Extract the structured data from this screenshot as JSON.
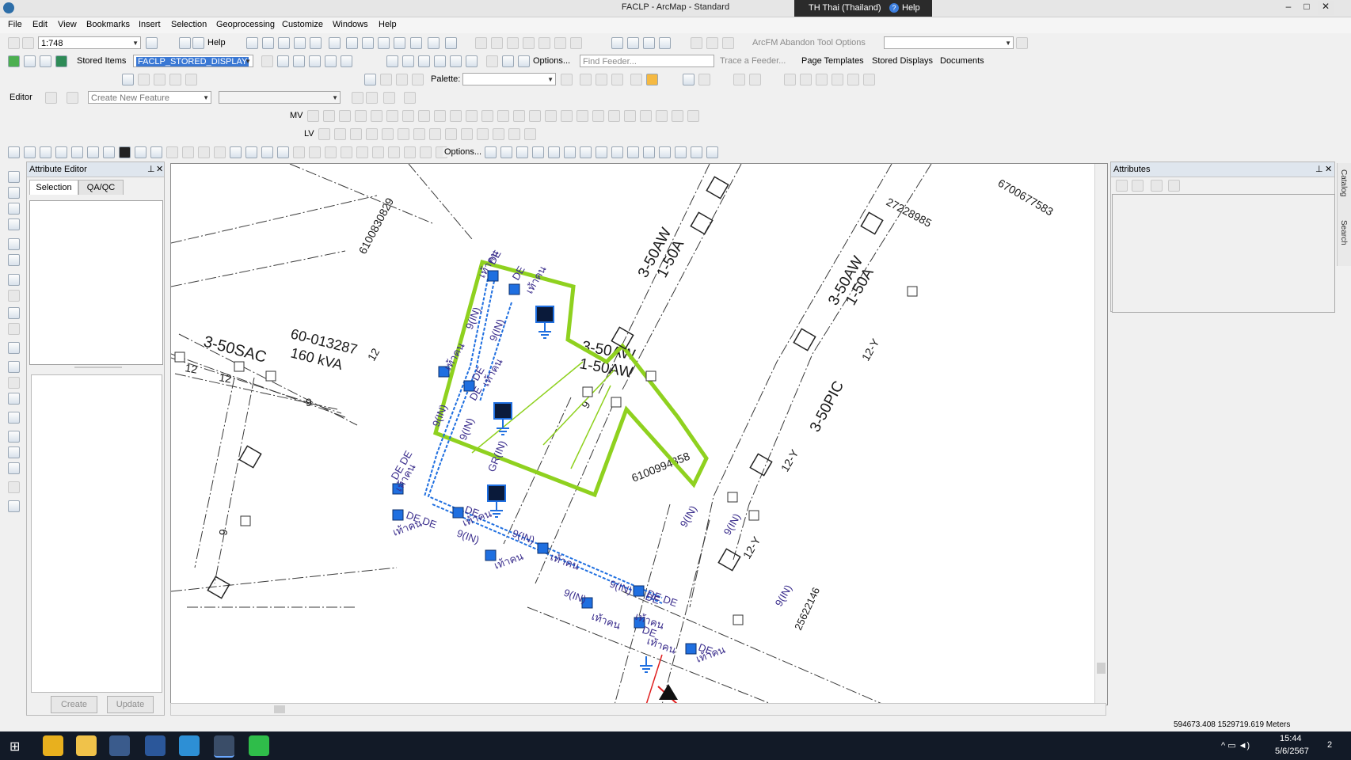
{
  "window": {
    "title": "FACLP - ArcMap - Standard",
    "language": "TH Thai (Thailand)",
    "help": "Help",
    "controls": [
      "–",
      "□",
      "✕"
    ]
  },
  "menu": [
    "File",
    "Edit",
    "View",
    "Bookmarks",
    "Insert",
    "Selection",
    "Geoprocessing",
    "Customize",
    "Windows",
    "Help"
  ],
  "toolbar": {
    "scale": "1:748",
    "help_label": "Help",
    "arcfm_abandon": "ArcFM Abandon Tool Options",
    "stored_items": "Stored Items",
    "stored_display": "FACLP_STORED_DISPLAY",
    "options_label": "Options...",
    "find_feeder_placeholder": "Find Feeder...",
    "trace_feeder": "Trace a Feeder...",
    "page_templates": "Page Templates",
    "stored_displays": "Stored Displays",
    "documents": "Documents",
    "palette_label": "Palette:",
    "editor_label": "Editor",
    "create_new_feature": "Create New Feature",
    "mv_label": "MV",
    "lv_label": "LV",
    "options2_label": "Options..."
  },
  "attribute_editor": {
    "title": "Attribute Editor",
    "tabs": [
      "Selection",
      "QA/QC"
    ],
    "create_button": "Create",
    "update_button": "Update"
  },
  "attributes_panel": {
    "title": "Attributes"
  },
  "right_strip": [
    "Catalog",
    "Search"
  ],
  "status": {
    "coordinates": "594673.408  1529719.619 Meters"
  },
  "clock": {
    "time": "15:44",
    "date": "5/6/2567",
    "notifications": "2"
  },
  "map_labels": {
    "id1": "6100830829",
    "id2": "6700677583",
    "id3": "27228985",
    "id4": "6100994358",
    "id5": "25622146",
    "cable1_a": "3-50SAC",
    "cable2_a": "3-50AW",
    "cable2_b": "1-50A",
    "cable3_a": "3-50AW",
    "cable3_b": "1-50A",
    "cable4_a": "3-50AW",
    "cable4_b": "1-50AW",
    "cable5": "3-50PIC",
    "transformer_id": "60-013287",
    "transformer_kva": "160 kVA",
    "n12a": "12",
    "n12b": "12",
    "n12c": "12",
    "n9a": "9",
    "n9b": "9",
    "n9c": "9",
    "n12y_a": "12-Y",
    "n12y_b": "12-Y",
    "n12y_c": "12-Y",
    "conductor1": "9(IN)",
    "conductor2": "9(IN)",
    "conductor3": "9(IN)",
    "conductor4": "9(IN)",
    "conductor5": "9(IN)",
    "conductor6": "9(IN)",
    "conductor7": "9(IN)",
    "conductor8": "9(IN)",
    "conductor9": "9(IN)",
    "conductor10": "9(IN)",
    "conductor11": "9(IN)",
    "grounding": "GR(IN)",
    "de1": "DE",
    "de2": "DE",
    "de3": "DE",
    "de4": "DE",
    "de5": "DE",
    "de6": "DE DE",
    "de7": "DE",
    "de8": "DE DE",
    "de9": "DE DE",
    "de10": "DE",
    "de11": "DE",
    "thai1": "เท้าคน",
    "thai2": "เท้าคน",
    "thai3": "เท้าคน",
    "thai4": "เท้าคน",
    "thai5": "เท้าคน",
    "thai6": "เท้าคน",
    "thai7": "เท้าคน",
    "thai8": "เท้าคน",
    "thai9": "เท้าคน",
    "thai10": "เท้าคน",
    "thai11": "เท้าคน",
    "thai12": "เท้าคน",
    "thai13": "เท้าคน"
  },
  "colors": {
    "selection_outline": "#8fd11f",
    "selected_feature": "#1f6fe0",
    "label_purple": "#3a2d8c"
  }
}
